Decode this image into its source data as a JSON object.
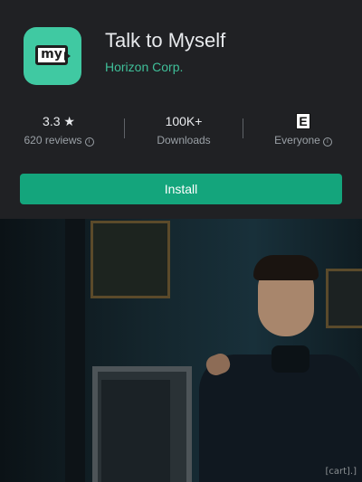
{
  "app": {
    "icon_text": "my",
    "title": "Talk to Myself",
    "developer": "Horizon Corp."
  },
  "stats": {
    "rating": "3.3",
    "star": "★",
    "reviews": "620 reviews",
    "downloads": "100K+",
    "downloads_label": "Downloads",
    "content_rating_icon": "E",
    "content_rating": "Everyone",
    "info_glyph": "i"
  },
  "install_label": "Install",
  "meme": {
    "watermark": "[cart].]"
  },
  "colors": {
    "accent": "#14a57c",
    "developer_text": "#3fbf99",
    "icon_bg": "#40c9a2",
    "background": "#202124"
  }
}
